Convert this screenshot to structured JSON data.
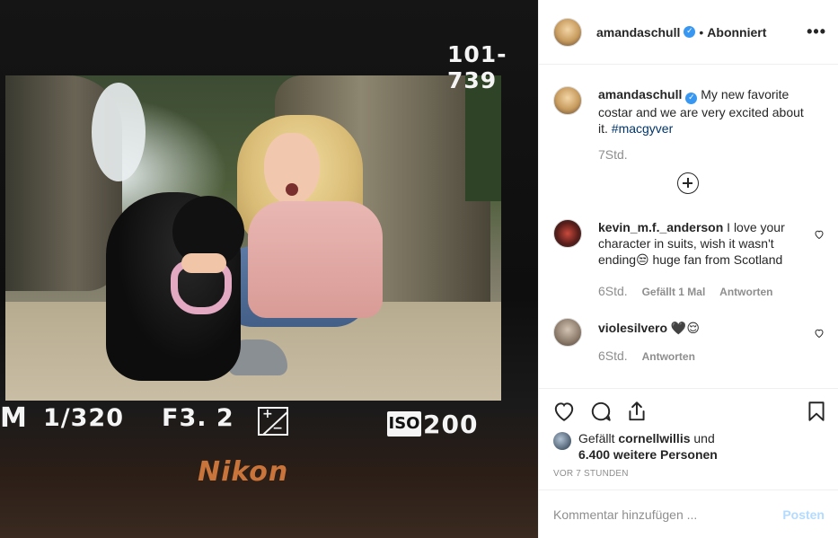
{
  "photo": {
    "lcd": {
      "counter": "101-739",
      "mode": "M",
      "shutter": "1/320",
      "fstop": "F3. 2",
      "iso_label": "ISO",
      "iso_value": "200"
    },
    "brand": "Nikon"
  },
  "header": {
    "username": "amandaschull",
    "verified": true,
    "separator": "•",
    "follow_status": "Abonniert",
    "more_icon": "more-horizontal-icon",
    "more_label": "•••"
  },
  "caption": {
    "username": "amandaschull",
    "text": " My new favorite costar and we are very excited about it. ",
    "hashtag": "#macgyver",
    "time": "7Std."
  },
  "load_more_icon": "plus-circle-icon",
  "comments": [
    {
      "username": "kevin_m.f._anderson",
      "text": " I love your character in suits, wish it wasn't ending😒 huge fan from Scotland",
      "time": "6Std.",
      "likes": "Gefällt 1 Mal",
      "reply": "Antworten"
    },
    {
      "username": "violesilvero",
      "text": " 🖤😌",
      "time": "6Std.",
      "reply": "Antworten"
    }
  ],
  "actions": {
    "like_icon": "heart-icon",
    "comment_icon": "comment-bubble-icon",
    "share_icon": "share-icon",
    "save_icon": "bookmark-icon"
  },
  "likes": {
    "prefix": "Gefällt ",
    "user": "cornellwillis",
    "middle": " und",
    "count_text": "6.400 weitere Personen"
  },
  "timestamp": "VOR 7 STUNDEN",
  "comment_box": {
    "placeholder": "Kommentar hinzufügen ...",
    "post_label": "Posten"
  },
  "colors": {
    "link": "#003569",
    "verified": "#3897f0",
    "post_disabled": "#b3dbff",
    "secondary_text": "#8e8e8e"
  }
}
